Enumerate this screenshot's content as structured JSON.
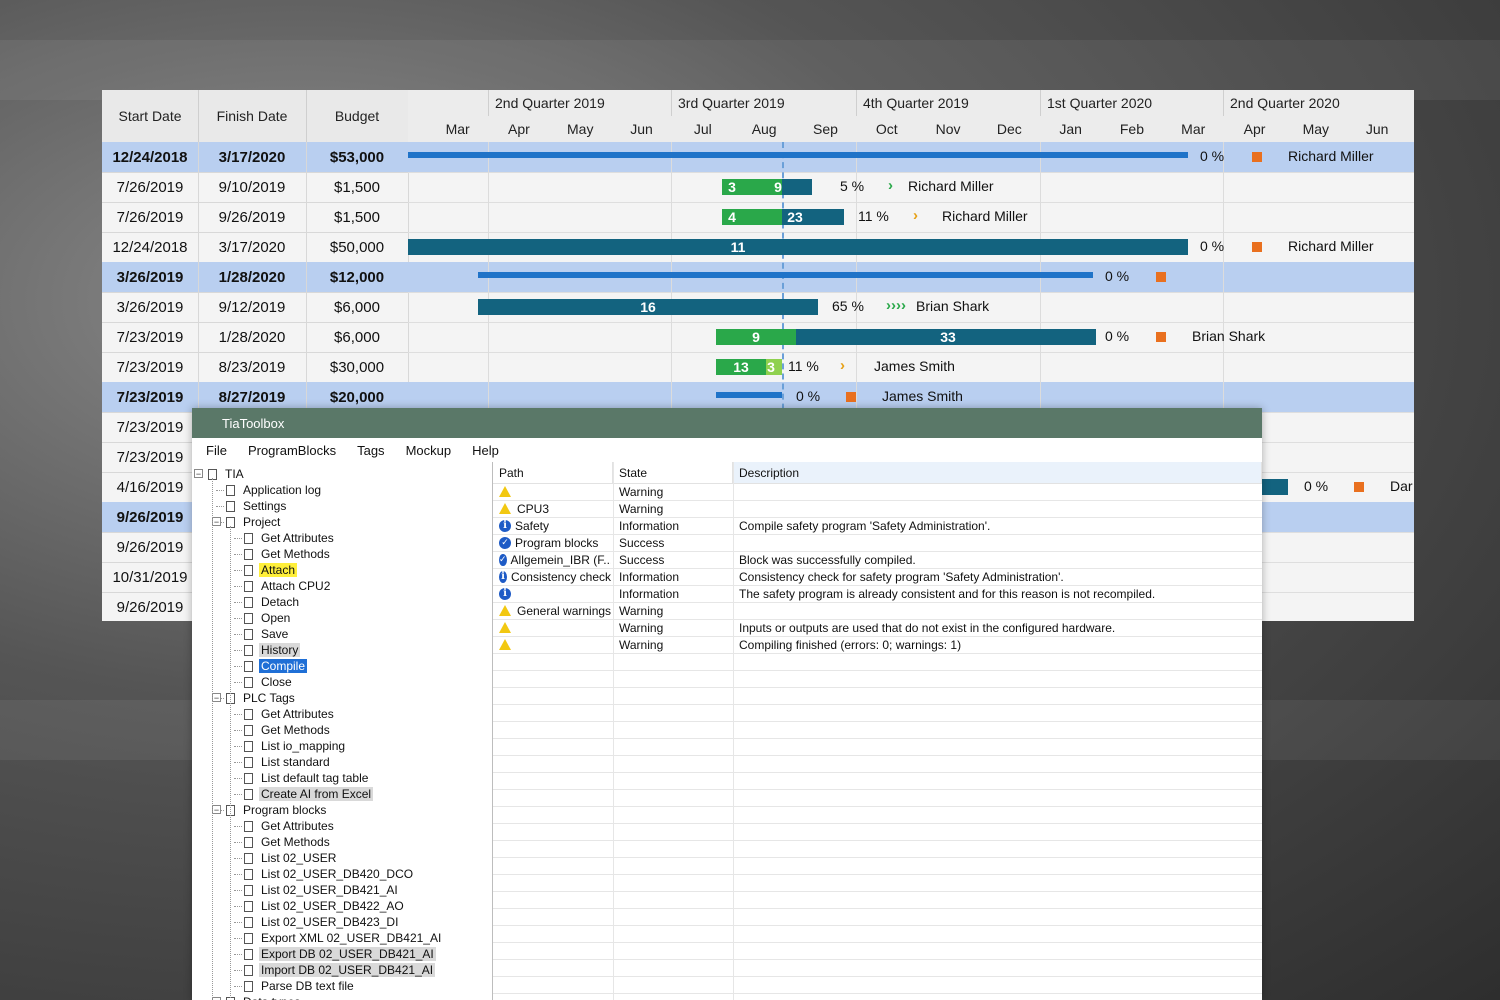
{
  "colors": {
    "accent_blue": "#1f73c8",
    "bar_dark": "#13637f",
    "bar_green": "#2aa84a",
    "bar_lightgreen": "#8fd14f",
    "milestone_orange": "#e9701f",
    "window_title": "#5a7868",
    "selection_blue": "#b9cff0"
  },
  "gantt": {
    "headers": {
      "start": "Start Date",
      "finish": "Finish Date",
      "budget": "Budget"
    },
    "quarters": [
      "2nd Quarter 2019",
      "3rd Quarter 2019",
      "4th Quarter 2019",
      "1st Quarter 2020",
      "2nd Quarter 2020"
    ],
    "months": [
      "Mar",
      "Apr",
      "May",
      "Jun",
      "Jul",
      "Aug",
      "Sep",
      "Oct",
      "Nov",
      "Dec",
      "Jan",
      "Feb",
      "Mar",
      "Apr",
      "May",
      "Jun"
    ],
    "rows": [
      {
        "start": "12/24/2018",
        "finish": "3/17/2020",
        "budget": "$53,000",
        "sel": true,
        "pct": "0 %",
        "res": "Richard Miller"
      },
      {
        "start": "7/26/2019",
        "finish": "9/10/2019",
        "budget": "$1,500",
        "sel": false,
        "pct": "5 %",
        "res": "Richard Miller"
      },
      {
        "start": "7/26/2019",
        "finish": "9/26/2019",
        "budget": "$1,500",
        "sel": false,
        "pct": "11 %",
        "res": "Richard Miller"
      },
      {
        "start": "12/24/2018",
        "finish": "3/17/2020",
        "budget": "$50,000",
        "sel": false,
        "pct": "0 %",
        "res": "Richard Miller"
      },
      {
        "start": "3/26/2019",
        "finish": "1/28/2020",
        "budget": "$12,000",
        "sel": true,
        "pct": "0 %",
        "res": ""
      },
      {
        "start": "3/26/2019",
        "finish": "9/12/2019",
        "budget": "$6,000",
        "sel": false,
        "pct": "65 %",
        "res": "Brian Shark"
      },
      {
        "start": "7/23/2019",
        "finish": "1/28/2020",
        "budget": "$6,000",
        "sel": false,
        "pct": "0 %",
        "res": "Brian Shark"
      },
      {
        "start": "7/23/2019",
        "finish": "8/23/2019",
        "budget": "$30,000",
        "sel": false,
        "pct": "11 %",
        "res": "James Smith"
      },
      {
        "start": "7/23/2019",
        "finish": "8/27/2019",
        "budget": "$20,000",
        "sel": true,
        "pct": "0 %",
        "res": "James Smith"
      },
      {
        "start": "7/23/2019",
        "finish": "",
        "budget": "",
        "sel": false,
        "pct": "",
        "res": ""
      },
      {
        "start": "7/23/2019",
        "finish": "",
        "budget": "",
        "sel": false,
        "pct": "",
        "res": ""
      },
      {
        "start": "4/16/2019",
        "finish": "",
        "budget": "",
        "sel": false,
        "pct": "0 %",
        "res": "Dar"
      },
      {
        "start": "9/26/2019",
        "finish": "",
        "budget": "",
        "sel": true,
        "pct": "",
        "res": ""
      },
      {
        "start": "9/26/2019",
        "finish": "",
        "budget": "",
        "sel": false,
        "pct": "",
        "res": ""
      },
      {
        "start": "10/31/2019",
        "finish": "",
        "budget": "",
        "sel": false,
        "pct": "",
        "res": ""
      },
      {
        "start": "9/26/2019",
        "finish": "",
        "budget": "",
        "sel": false,
        "pct": "",
        "res": ""
      }
    ],
    "bar_numbers": {
      "r1a": "3",
      "r1b": "9",
      "r2a": "4",
      "r2b": "23",
      "r3": "11",
      "r5": "16",
      "r6a": "9",
      "r6b": "33",
      "r7a": "13",
      "r7b": "3"
    }
  },
  "tia": {
    "title": "TiaToolbox",
    "menu": [
      "File",
      "ProgramBlocks",
      "Tags",
      "Mockup",
      "Help"
    ],
    "tree": [
      {
        "label": "TIA",
        "level": 0,
        "toggle": "−",
        "hl": ""
      },
      {
        "label": "Application log",
        "level": 1,
        "toggle": "",
        "hl": ""
      },
      {
        "label": "Settings",
        "level": 1,
        "toggle": "",
        "hl": ""
      },
      {
        "label": "Project",
        "level": 1,
        "toggle": "−",
        "hl": ""
      },
      {
        "label": "Get Attributes",
        "level": 2,
        "toggle": "",
        "hl": ""
      },
      {
        "label": "Get Methods",
        "level": 2,
        "toggle": "",
        "hl": ""
      },
      {
        "label": "Attach",
        "level": 2,
        "toggle": "",
        "hl": "yellow"
      },
      {
        "label": "Attach CPU2",
        "level": 2,
        "toggle": "",
        "hl": ""
      },
      {
        "label": "Detach",
        "level": 2,
        "toggle": "",
        "hl": ""
      },
      {
        "label": "Open",
        "level": 2,
        "toggle": "",
        "hl": ""
      },
      {
        "label": "Save",
        "level": 2,
        "toggle": "",
        "hl": ""
      },
      {
        "label": "History",
        "level": 2,
        "toggle": "",
        "hl": "gray"
      },
      {
        "label": "Compile",
        "level": 2,
        "toggle": "",
        "hl": "blue"
      },
      {
        "label": "Close",
        "level": 2,
        "toggle": "",
        "hl": ""
      },
      {
        "label": "PLC Tags",
        "level": 1,
        "toggle": "−",
        "hl": ""
      },
      {
        "label": "Get Attributes",
        "level": 2,
        "toggle": "",
        "hl": ""
      },
      {
        "label": "Get Methods",
        "level": 2,
        "toggle": "",
        "hl": ""
      },
      {
        "label": "List io_mapping",
        "level": 2,
        "toggle": "",
        "hl": ""
      },
      {
        "label": "List standard",
        "level": 2,
        "toggle": "",
        "hl": ""
      },
      {
        "label": "List default tag table",
        "level": 2,
        "toggle": "",
        "hl": ""
      },
      {
        "label": "Create AI from Excel",
        "level": 2,
        "toggle": "",
        "hl": "gray"
      },
      {
        "label": "Program blocks",
        "level": 1,
        "toggle": "−",
        "hl": ""
      },
      {
        "label": "Get Attributes",
        "level": 2,
        "toggle": "",
        "hl": ""
      },
      {
        "label": "Get Methods",
        "level": 2,
        "toggle": "",
        "hl": ""
      },
      {
        "label": "List 02_USER",
        "level": 2,
        "toggle": "",
        "hl": ""
      },
      {
        "label": "List 02_USER_DB420_DCO",
        "level": 2,
        "toggle": "",
        "hl": ""
      },
      {
        "label": "List 02_USER_DB421_AI",
        "level": 2,
        "toggle": "",
        "hl": ""
      },
      {
        "label": "List 02_USER_DB422_AO",
        "level": 2,
        "toggle": "",
        "hl": ""
      },
      {
        "label": "List 02_USER_DB423_DI",
        "level": 2,
        "toggle": "",
        "hl": ""
      },
      {
        "label": "Export XML 02_USER_DB421_AI",
        "level": 2,
        "toggle": "",
        "hl": ""
      },
      {
        "label": "Export DB 02_USER_DB421_AI",
        "level": 2,
        "toggle": "",
        "hl": "gray"
      },
      {
        "label": "Import DB 02_USER_DB421_AI",
        "level": 2,
        "toggle": "",
        "hl": "gray"
      },
      {
        "label": "Parse DB text file",
        "level": 2,
        "toggle": "",
        "hl": ""
      },
      {
        "label": "Data types",
        "level": 1,
        "toggle": "−",
        "hl": ""
      }
    ],
    "log_headers": {
      "path": "Path",
      "state": "State",
      "description": "Description"
    },
    "log": [
      {
        "icon": "warn",
        "path": "",
        "state": "Warning",
        "desc": ""
      },
      {
        "icon": "warn",
        "path": "CPU3",
        "state": "Warning",
        "desc": ""
      },
      {
        "icon": "info",
        "path": "Safety",
        "state": "Information",
        "desc": "Compile safety program 'Safety Administration'."
      },
      {
        "icon": "ok",
        "path": "Program blocks",
        "state": "Success",
        "desc": ""
      },
      {
        "icon": "ok",
        "path": "Allgemein_IBR (F...",
        "state": "Success",
        "desc": "Block was successfully compiled."
      },
      {
        "icon": "info",
        "path": "Consistency check",
        "state": "Information",
        "desc": "Consistency check for safety program 'Safety Administration'."
      },
      {
        "icon": "info",
        "path": "",
        "state": "Information",
        "desc": "The safety program is already consistent and for this reason is not recompiled."
      },
      {
        "icon": "warn",
        "path": "General warnings",
        "state": "Warning",
        "desc": ""
      },
      {
        "icon": "warn",
        "path": "",
        "state": "Warning",
        "desc": "Inputs or outputs are used that do not exist in the configured hardware."
      },
      {
        "icon": "warn",
        "path": "",
        "state": "Warning",
        "desc": "Compiling finished (errors: 0; warnings: 1)"
      }
    ]
  }
}
